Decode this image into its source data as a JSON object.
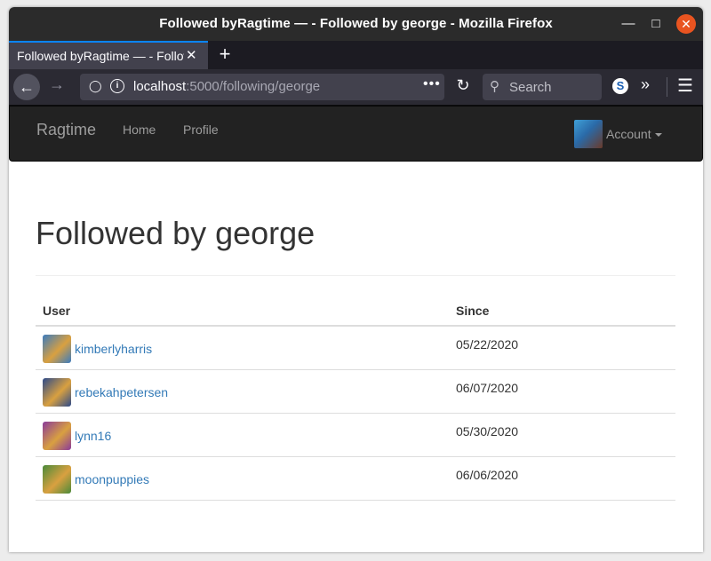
{
  "window": {
    "title": "Followed byRagtime — - Followed by george - Mozilla Firefox",
    "tab_title": "Followed byRagtime — - Followed by george",
    "url_host": "localhost",
    "url_rest": ":5000/following/george",
    "search_placeholder": "Search"
  },
  "app": {
    "brand": "Ragtime",
    "nav": [
      "Home",
      "Profile"
    ],
    "account_label": "Account"
  },
  "page": {
    "title": "Followed by george",
    "columns": {
      "user": "User",
      "since": "Since"
    },
    "rows": [
      {
        "username": "kimberlyharris",
        "since": "05/22/2020",
        "avatar_color": "#3a7bbf"
      },
      {
        "username": "rebekahpetersen",
        "since": "06/07/2020",
        "avatar_color": "#2c4a8a"
      },
      {
        "username": "lynn16",
        "since": "05/30/2020",
        "avatar_color": "#8a3a9a"
      },
      {
        "username": "moonpuppies",
        "since": "06/06/2020",
        "avatar_color": "#4a8a3a"
      }
    ]
  },
  "colors": {
    "link": "#337ab7",
    "navbar_bg": "#222222",
    "close_button": "#e95420",
    "tab_accent": "#0a84ff"
  }
}
